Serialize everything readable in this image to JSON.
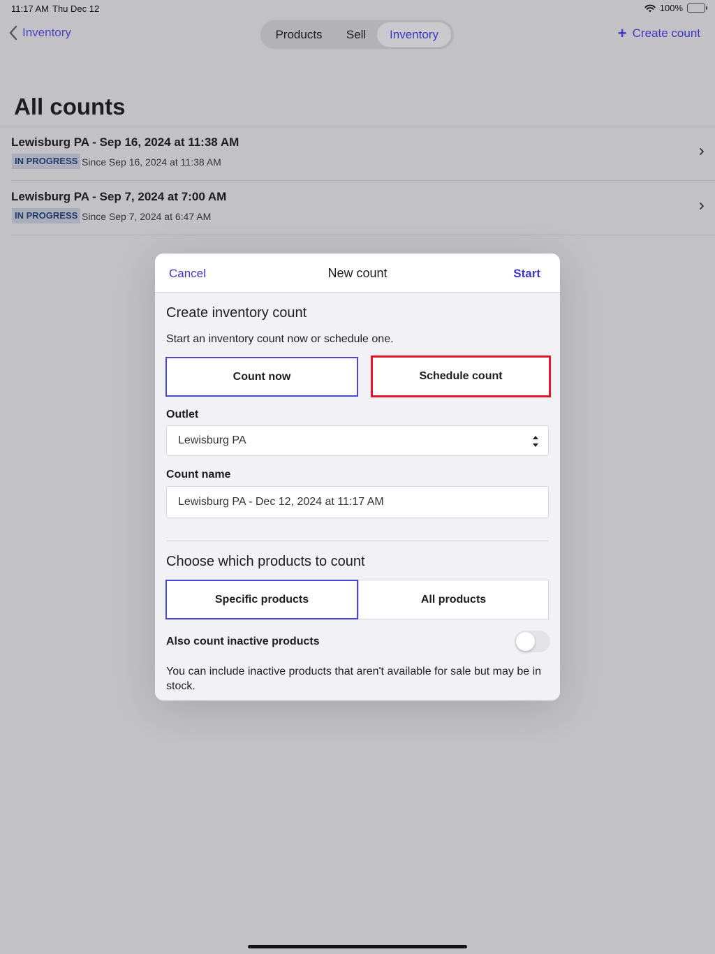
{
  "status_bar": {
    "time": "11:17 AM",
    "date": "Thu Dec 12",
    "battery": "100%"
  },
  "nav": {
    "back_label": "Inventory",
    "segments": [
      "Products",
      "Sell",
      "Inventory"
    ],
    "selected_segment": "Inventory",
    "create_label": "Create count",
    "accent_color": "#3d36c2"
  },
  "page": {
    "title": "All counts"
  },
  "counts": [
    {
      "title": "Lewisburg PA - Sep 16, 2024 at 11:38 AM",
      "status": "IN PROGRESS",
      "since": "Since Sep 16, 2024 at 11:38 AM"
    },
    {
      "title": "Lewisburg PA - Sep 7, 2024 at 7:00 AM",
      "status": "IN PROGRESS",
      "since": "Since Sep 7, 2024 at 6:47 AM"
    }
  ],
  "modal": {
    "cancel": "Cancel",
    "title": "New count",
    "start": "Start",
    "create_heading": "Create inventory count",
    "create_desc": "Start an inventory count now or schedule one.",
    "count_now": "Count now",
    "schedule_count": "Schedule count",
    "outlet_label": "Outlet",
    "outlet_value": "Lewisburg PA",
    "count_name_label": "Count name",
    "count_name_value": "Lewisburg PA - Dec 12, 2024 at 11:17 AM",
    "products_heading": "Choose which products to count",
    "specific_products": "Specific products",
    "all_products": "All products",
    "inactive_label": "Also count inactive products",
    "inactive_enabled": false,
    "inactive_desc": "You can include inactive products that aren't available for sale but may be in stock."
  }
}
